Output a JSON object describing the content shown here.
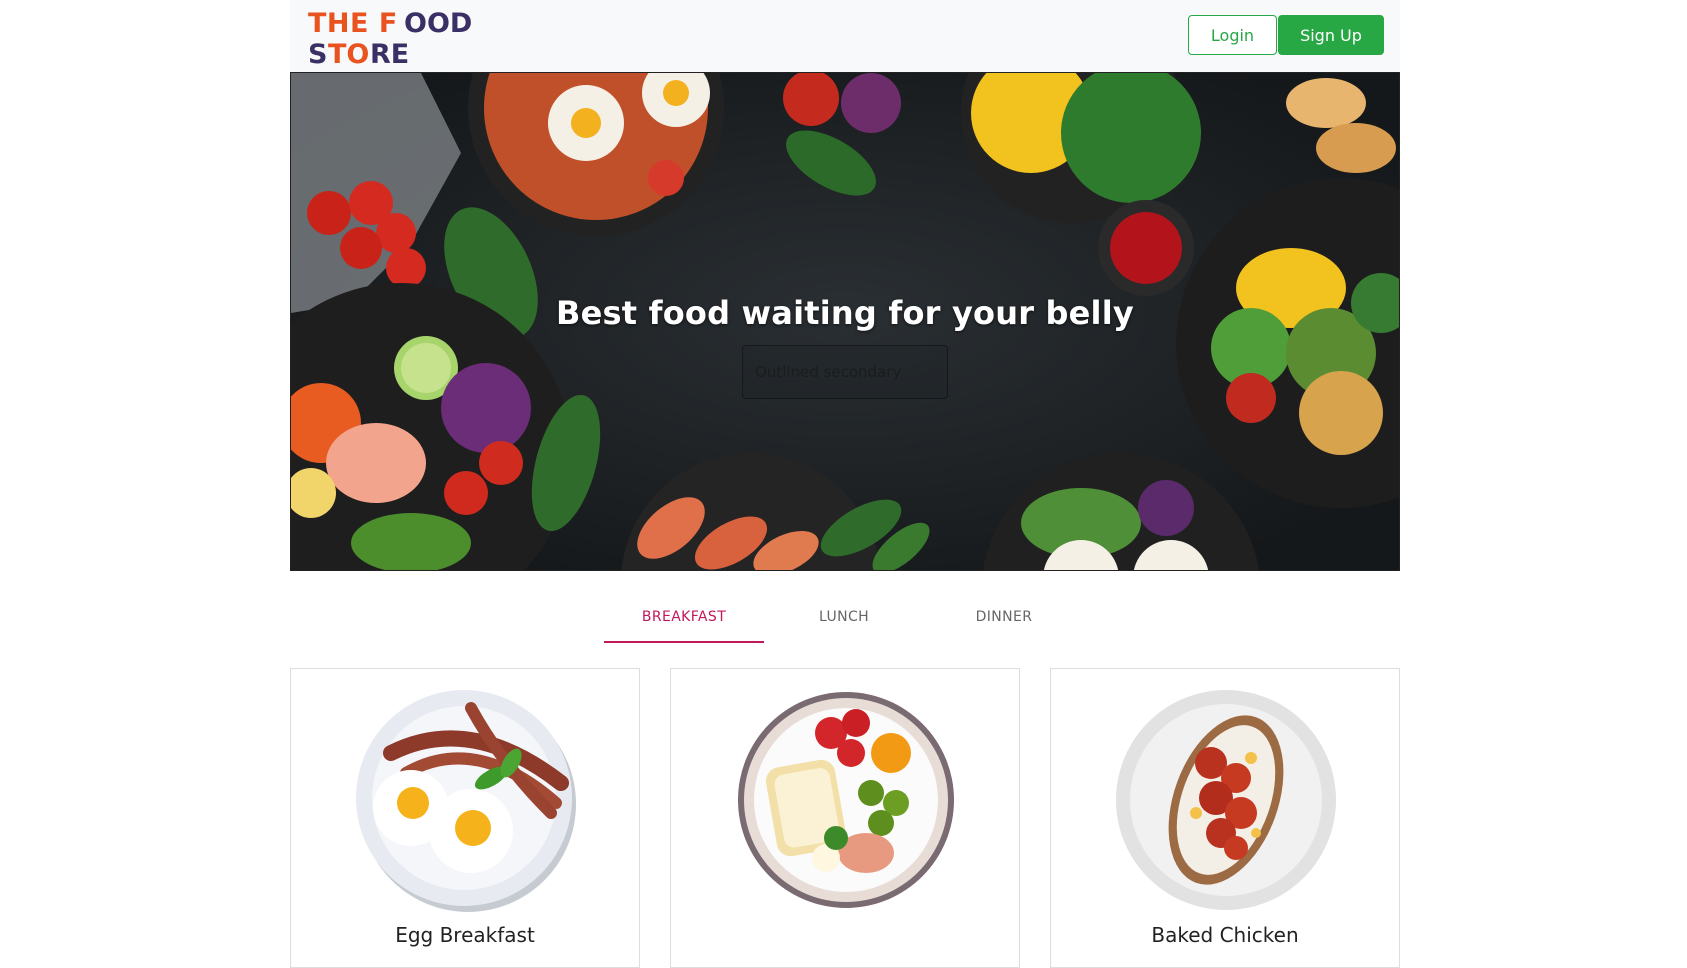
{
  "brand": {
    "logo_line1": "THE FOOD",
    "logo_line2": "STORE"
  },
  "header": {
    "login_label": "Login",
    "signup_label": "Sign Up"
  },
  "hero": {
    "title": "Best food waiting for your belly",
    "input_placeholder": "Outlined secondary"
  },
  "tabs": [
    {
      "label": "BREAKFAST",
      "active": true
    },
    {
      "label": "LUNCH",
      "active": false
    },
    {
      "label": "DINNER",
      "active": false
    }
  ],
  "cards": [
    {
      "title": "Egg Breakfast"
    },
    {
      "title": ""
    },
    {
      "title": "Baked Chicken"
    }
  ],
  "colors": {
    "accent": "#c2185b",
    "button_green": "#28a745",
    "logo_orange": "#e8531f",
    "logo_purple": "#3b3065"
  }
}
